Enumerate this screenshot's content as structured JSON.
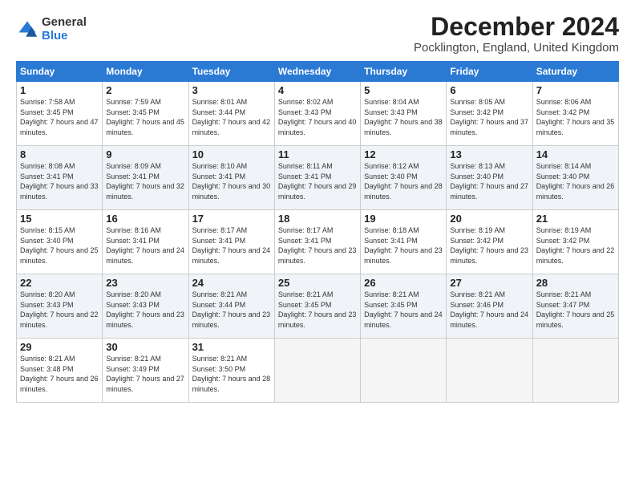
{
  "header": {
    "logo_general": "General",
    "logo_blue": "Blue",
    "month_title": "December 2024",
    "subtitle": "Pocklington, England, United Kingdom"
  },
  "days_of_week": [
    "Sunday",
    "Monday",
    "Tuesday",
    "Wednesday",
    "Thursday",
    "Friday",
    "Saturday"
  ],
  "weeks": [
    [
      {
        "day": "1",
        "sunrise": "7:58 AM",
        "sunset": "3:45 PM",
        "daylight": "7 hours and 47 minutes."
      },
      {
        "day": "2",
        "sunrise": "7:59 AM",
        "sunset": "3:45 PM",
        "daylight": "7 hours and 45 minutes."
      },
      {
        "day": "3",
        "sunrise": "8:01 AM",
        "sunset": "3:44 PM",
        "daylight": "7 hours and 42 minutes."
      },
      {
        "day": "4",
        "sunrise": "8:02 AM",
        "sunset": "3:43 PM",
        "daylight": "7 hours and 40 minutes."
      },
      {
        "day": "5",
        "sunrise": "8:04 AM",
        "sunset": "3:43 PM",
        "daylight": "7 hours and 38 minutes."
      },
      {
        "day": "6",
        "sunrise": "8:05 AM",
        "sunset": "3:42 PM",
        "daylight": "7 hours and 37 minutes."
      },
      {
        "day": "7",
        "sunrise": "8:06 AM",
        "sunset": "3:42 PM",
        "daylight": "7 hours and 35 minutes."
      }
    ],
    [
      {
        "day": "8",
        "sunrise": "8:08 AM",
        "sunset": "3:41 PM",
        "daylight": "7 hours and 33 minutes."
      },
      {
        "day": "9",
        "sunrise": "8:09 AM",
        "sunset": "3:41 PM",
        "daylight": "7 hours and 32 minutes."
      },
      {
        "day": "10",
        "sunrise": "8:10 AM",
        "sunset": "3:41 PM",
        "daylight": "7 hours and 30 minutes."
      },
      {
        "day": "11",
        "sunrise": "8:11 AM",
        "sunset": "3:41 PM",
        "daylight": "7 hours and 29 minutes."
      },
      {
        "day": "12",
        "sunrise": "8:12 AM",
        "sunset": "3:40 PM",
        "daylight": "7 hours and 28 minutes."
      },
      {
        "day": "13",
        "sunrise": "8:13 AM",
        "sunset": "3:40 PM",
        "daylight": "7 hours and 27 minutes."
      },
      {
        "day": "14",
        "sunrise": "8:14 AM",
        "sunset": "3:40 PM",
        "daylight": "7 hours and 26 minutes."
      }
    ],
    [
      {
        "day": "15",
        "sunrise": "8:15 AM",
        "sunset": "3:40 PM",
        "daylight": "7 hours and 25 minutes."
      },
      {
        "day": "16",
        "sunrise": "8:16 AM",
        "sunset": "3:41 PM",
        "daylight": "7 hours and 24 minutes."
      },
      {
        "day": "17",
        "sunrise": "8:17 AM",
        "sunset": "3:41 PM",
        "daylight": "7 hours and 24 minutes."
      },
      {
        "day": "18",
        "sunrise": "8:17 AM",
        "sunset": "3:41 PM",
        "daylight": "7 hours and 23 minutes."
      },
      {
        "day": "19",
        "sunrise": "8:18 AM",
        "sunset": "3:41 PM",
        "daylight": "7 hours and 23 minutes."
      },
      {
        "day": "20",
        "sunrise": "8:19 AM",
        "sunset": "3:42 PM",
        "daylight": "7 hours and 23 minutes."
      },
      {
        "day": "21",
        "sunrise": "8:19 AM",
        "sunset": "3:42 PM",
        "daylight": "7 hours and 22 minutes."
      }
    ],
    [
      {
        "day": "22",
        "sunrise": "8:20 AM",
        "sunset": "3:43 PM",
        "daylight": "7 hours and 22 minutes."
      },
      {
        "day": "23",
        "sunrise": "8:20 AM",
        "sunset": "3:43 PM",
        "daylight": "7 hours and 23 minutes."
      },
      {
        "day": "24",
        "sunrise": "8:21 AM",
        "sunset": "3:44 PM",
        "daylight": "7 hours and 23 minutes."
      },
      {
        "day": "25",
        "sunrise": "8:21 AM",
        "sunset": "3:45 PM",
        "daylight": "7 hours and 23 minutes."
      },
      {
        "day": "26",
        "sunrise": "8:21 AM",
        "sunset": "3:45 PM",
        "daylight": "7 hours and 24 minutes."
      },
      {
        "day": "27",
        "sunrise": "8:21 AM",
        "sunset": "3:46 PM",
        "daylight": "7 hours and 24 minutes."
      },
      {
        "day": "28",
        "sunrise": "8:21 AM",
        "sunset": "3:47 PM",
        "daylight": "7 hours and 25 minutes."
      }
    ],
    [
      {
        "day": "29",
        "sunrise": "8:21 AM",
        "sunset": "3:48 PM",
        "daylight": "7 hours and 26 minutes."
      },
      {
        "day": "30",
        "sunrise": "8:21 AM",
        "sunset": "3:49 PM",
        "daylight": "7 hours and 27 minutes."
      },
      {
        "day": "31",
        "sunrise": "8:21 AM",
        "sunset": "3:50 PM",
        "daylight": "7 hours and 28 minutes."
      },
      null,
      null,
      null,
      null
    ]
  ]
}
